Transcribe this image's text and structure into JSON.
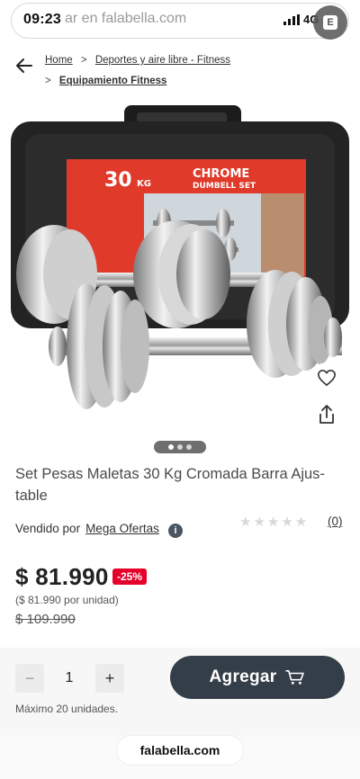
{
  "status": {
    "time": "09:23",
    "network": "4G"
  },
  "search": {
    "text": "ar en falabella.com"
  },
  "account": {
    "badge": "E"
  },
  "breadcrumb": {
    "home": "Home",
    "sep": ">",
    "category": "Deportes y aire libre - Fitness",
    "subcategory": "Equipamiento Fitness"
  },
  "product": {
    "title": "Set Pesas Maletas 30 Kg Cromada Barra Ajus-table",
    "image": {
      "box_weight": "30",
      "box_unit": "KG",
      "box_line1": "CHROME",
      "box_line2": "DUMBELL SET"
    },
    "carousel_index": 1,
    "carousel_count": 3
  },
  "seller": {
    "label": "Vendido por",
    "name": "Mega Ofertas",
    "info": "i"
  },
  "rating": {
    "stars": "★★★★★",
    "reviews": "(0)"
  },
  "price": {
    "current": "$ 81.990",
    "discount": "-25%",
    "per_unit": "($ 81.990 por unidad)",
    "original": "$ 109.990"
  },
  "cart": {
    "minus": "−",
    "quantity": "1",
    "plus": "+",
    "add_label": "Agregar",
    "max_units": "Máximo 20 unidades."
  },
  "browser": {
    "domain": "falabella.com"
  },
  "colors": {
    "accent_red": "#e4002b",
    "button_dark": "#343e48"
  }
}
